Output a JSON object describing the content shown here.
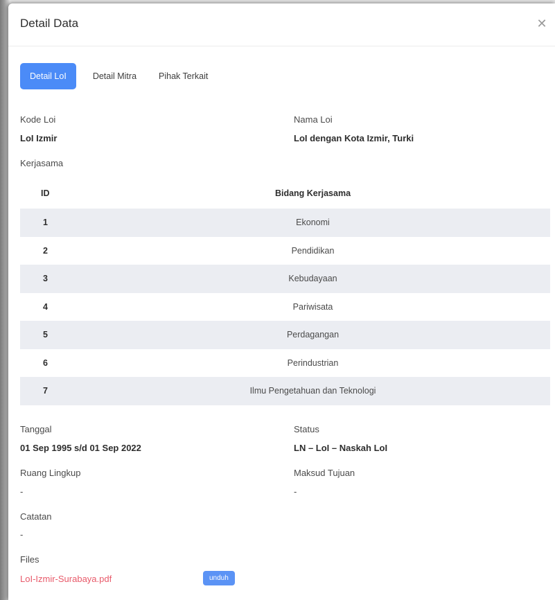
{
  "modal": {
    "title": "Detail Data",
    "close_icon": "close-icon"
  },
  "tabs": [
    {
      "label": "Detail LoI",
      "active": true
    },
    {
      "label": "Detail Mitra",
      "active": false
    },
    {
      "label": "Pihak Terkait",
      "active": false
    }
  ],
  "fields": {
    "kode_loi_label": "Kode Loi",
    "kode_loi_value": "LoI Izmir",
    "nama_loi_label": "Nama Loi",
    "nama_loi_value": "LoI dengan Kota Izmir, Turki",
    "kerjasama_label": "Kerjasama",
    "tanggal_label": "Tanggal",
    "tanggal_value": "01 Sep 1995 s/d 01 Sep 2022",
    "status_label": "Status",
    "status_value": "LN – LoI – Naskah LoI",
    "ruang_lingkup_label": "Ruang Lingkup",
    "ruang_lingkup_value": "-",
    "maksud_tujuan_label": "Maksud Tujuan",
    "maksud_tujuan_value": "-",
    "catatan_label": "Catatan",
    "catatan_value": "-",
    "files_label": "Files"
  },
  "kerjasama_table": {
    "headers": [
      "ID",
      "Bidang Kerjasama"
    ],
    "rows": [
      {
        "id": "1",
        "name": "Ekonomi"
      },
      {
        "id": "2",
        "name": "Pendidikan"
      },
      {
        "id": "3",
        "name": "Kebudayaan"
      },
      {
        "id": "4",
        "name": "Pariwisata"
      },
      {
        "id": "5",
        "name": "Perdagangan"
      },
      {
        "id": "6",
        "name": "Perindustrian"
      },
      {
        "id": "7",
        "name": "Ilmu Pengetahuan dan Teknologi"
      }
    ]
  },
  "files": {
    "filename": "LoI-Izmir-Surabaya.pdf",
    "download_label": "unduh"
  },
  "colors": {
    "accent": "#4b8bf7",
    "file_link": "#e85a6a",
    "row_stripe": "#ebedf2"
  }
}
